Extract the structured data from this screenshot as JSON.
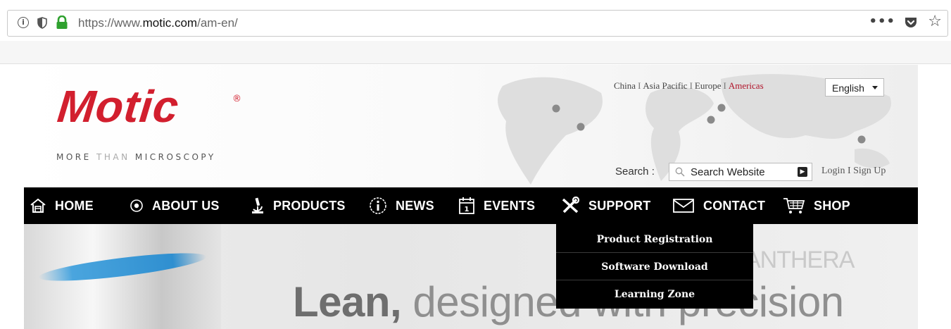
{
  "browser": {
    "url_prefix": "https://www.",
    "url_domain": "motic.com",
    "url_path": "/am-en/",
    "icons": [
      "info-icon",
      "tracking-shield-icon",
      "lock-icon",
      "more-icon",
      "pocket-icon",
      "bookmark-star-icon"
    ]
  },
  "header": {
    "logo_text": "Motic",
    "logo_mark": "®",
    "tagline": {
      "part1": "MORE ",
      "part2": "THAN ",
      "part3": "MICROSCOPY"
    },
    "regions": [
      "China",
      "Asia Pacific",
      "Europe",
      "Americas"
    ],
    "active_region": "Americas",
    "language": "English",
    "search_label": "Search :",
    "search_placeholder": "Search Website",
    "login_links": "Login I Sign Up",
    "brand_color": "#d21f2e"
  },
  "nav": {
    "items": [
      {
        "label": "HOME",
        "icon": "home-icon"
      },
      {
        "label": "ABOUT US",
        "icon": "target-icon"
      },
      {
        "label": "PRODUCTS",
        "icon": "microscope-icon"
      },
      {
        "label": "NEWS",
        "icon": "info-circle-icon"
      },
      {
        "label": "EVENTS",
        "icon": "calendar-icon"
      },
      {
        "label": "SUPPORT",
        "icon": "tools-icon"
      },
      {
        "label": "CONTACT",
        "icon": "envelope-icon"
      },
      {
        "label": "SHOP",
        "icon": "cart-icon"
      }
    ]
  },
  "support_menu": {
    "items": [
      "Product Registration",
      "Software Download",
      "Learning Zone"
    ]
  },
  "hero": {
    "brand_word": "ANTHERA",
    "headline_bold": "Lean,",
    "headline_rest": " designed with precision"
  }
}
